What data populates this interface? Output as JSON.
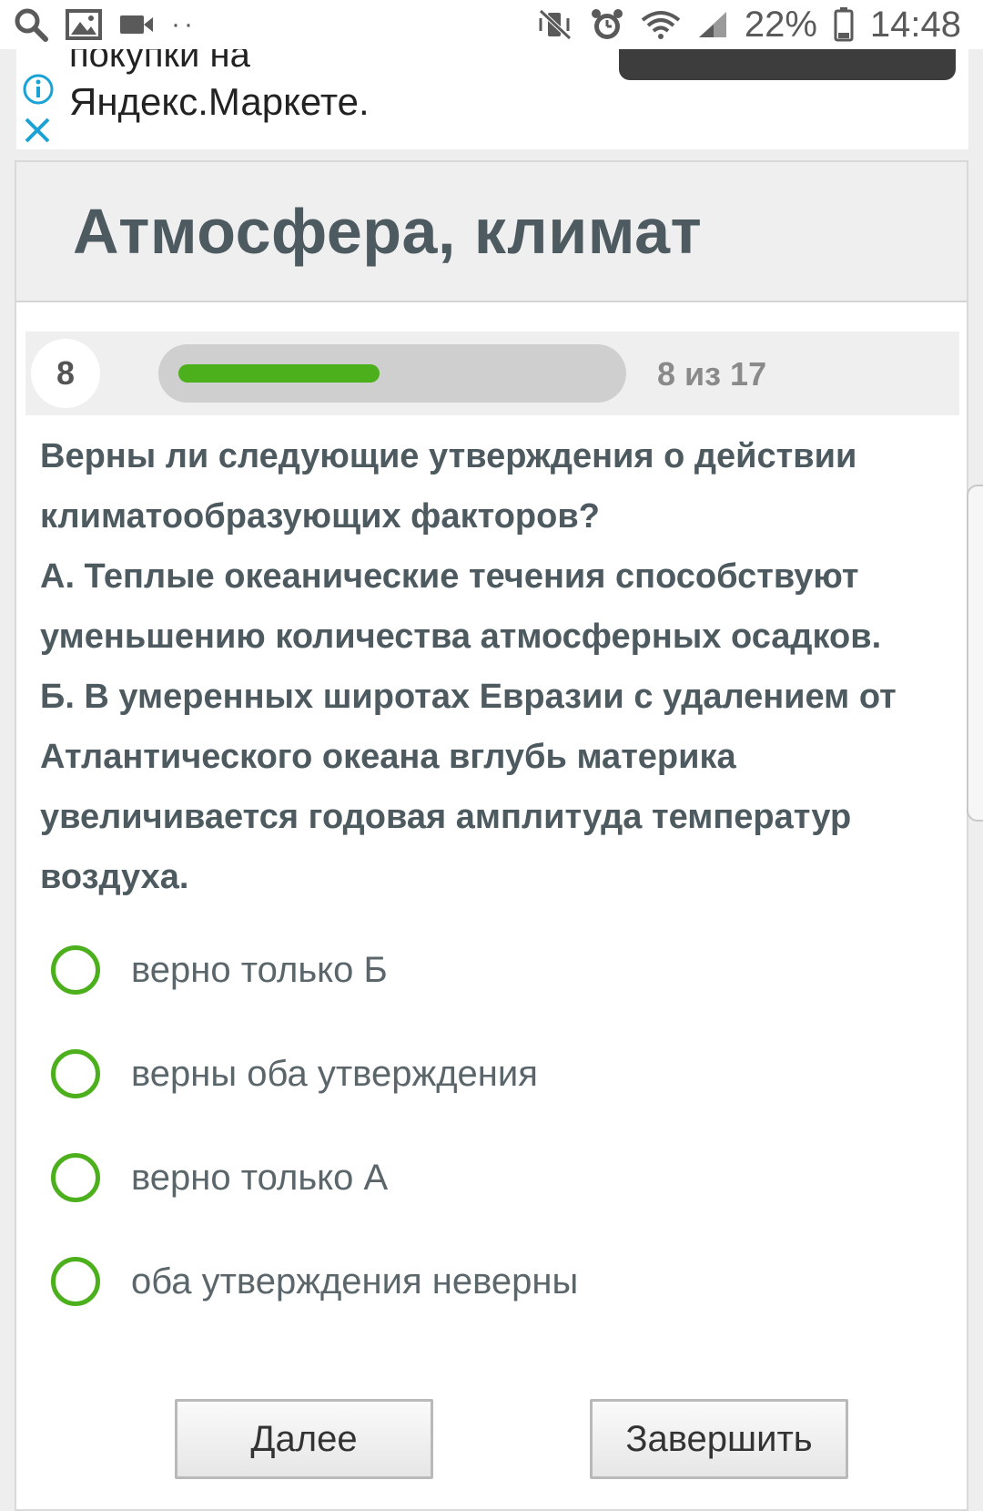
{
  "status_bar": {
    "battery": "22%",
    "time": "14:48",
    "left_icons": [
      "search-icon",
      "image-icon",
      "video-camera-icon",
      "more-dots-icon"
    ],
    "right_icons": [
      "mute-vibrate-icon",
      "alarm-icon",
      "wifi-icon",
      "signal-icon",
      "battery-icon"
    ]
  },
  "ad": {
    "text_top": "покупки на",
    "text": "Яндекс.Маркете."
  },
  "quiz": {
    "title": "Атмосфера, климат",
    "question_number": "8",
    "progress": {
      "current": 8,
      "total": 17,
      "fraction": 0.47,
      "label": "8 из 17"
    },
    "question_lines": [
      "Верны ли следующие утверждения о действии климатообразующих факторов?",
      "А. Теплые океанические течения способствуют уменьшению количества атмосферных осадков.",
      "Б. В умеренных широтах Евразии с удалением от Атлантического океана вглубь материка увеличивается годовая амплитуда температур воздуха."
    ],
    "options": [
      "верно только Б",
      "верны оба утверждения",
      "верно только А",
      "оба утверждения неверны"
    ],
    "next_label": "Далее",
    "finish_label": "Завершить"
  },
  "colors": {
    "accent_green": "#4caf1c",
    "text_dark": "#4d5a5f",
    "progress_track": "#cfcfcf"
  }
}
